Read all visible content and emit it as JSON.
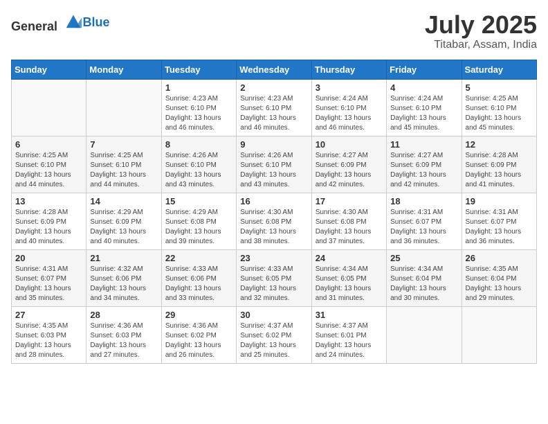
{
  "header": {
    "logo_general": "General",
    "logo_blue": "Blue",
    "month_year": "July 2025",
    "location": "Titabar, Assam, India"
  },
  "weekdays": [
    "Sunday",
    "Monday",
    "Tuesday",
    "Wednesday",
    "Thursday",
    "Friday",
    "Saturday"
  ],
  "weeks": [
    [
      {
        "day": "",
        "info": ""
      },
      {
        "day": "",
        "info": ""
      },
      {
        "day": "1",
        "info": "Sunrise: 4:23 AM\nSunset: 6:10 PM\nDaylight: 13 hours and 46 minutes."
      },
      {
        "day": "2",
        "info": "Sunrise: 4:23 AM\nSunset: 6:10 PM\nDaylight: 13 hours and 46 minutes."
      },
      {
        "day": "3",
        "info": "Sunrise: 4:24 AM\nSunset: 6:10 PM\nDaylight: 13 hours and 46 minutes."
      },
      {
        "day": "4",
        "info": "Sunrise: 4:24 AM\nSunset: 6:10 PM\nDaylight: 13 hours and 45 minutes."
      },
      {
        "day": "5",
        "info": "Sunrise: 4:25 AM\nSunset: 6:10 PM\nDaylight: 13 hours and 45 minutes."
      }
    ],
    [
      {
        "day": "6",
        "info": "Sunrise: 4:25 AM\nSunset: 6:10 PM\nDaylight: 13 hours and 44 minutes."
      },
      {
        "day": "7",
        "info": "Sunrise: 4:25 AM\nSunset: 6:10 PM\nDaylight: 13 hours and 44 minutes."
      },
      {
        "day": "8",
        "info": "Sunrise: 4:26 AM\nSunset: 6:10 PM\nDaylight: 13 hours and 43 minutes."
      },
      {
        "day": "9",
        "info": "Sunrise: 4:26 AM\nSunset: 6:10 PM\nDaylight: 13 hours and 43 minutes."
      },
      {
        "day": "10",
        "info": "Sunrise: 4:27 AM\nSunset: 6:09 PM\nDaylight: 13 hours and 42 minutes."
      },
      {
        "day": "11",
        "info": "Sunrise: 4:27 AM\nSunset: 6:09 PM\nDaylight: 13 hours and 42 minutes."
      },
      {
        "day": "12",
        "info": "Sunrise: 4:28 AM\nSunset: 6:09 PM\nDaylight: 13 hours and 41 minutes."
      }
    ],
    [
      {
        "day": "13",
        "info": "Sunrise: 4:28 AM\nSunset: 6:09 PM\nDaylight: 13 hours and 40 minutes."
      },
      {
        "day": "14",
        "info": "Sunrise: 4:29 AM\nSunset: 6:09 PM\nDaylight: 13 hours and 40 minutes."
      },
      {
        "day": "15",
        "info": "Sunrise: 4:29 AM\nSunset: 6:08 PM\nDaylight: 13 hours and 39 minutes."
      },
      {
        "day": "16",
        "info": "Sunrise: 4:30 AM\nSunset: 6:08 PM\nDaylight: 13 hours and 38 minutes."
      },
      {
        "day": "17",
        "info": "Sunrise: 4:30 AM\nSunset: 6:08 PM\nDaylight: 13 hours and 37 minutes."
      },
      {
        "day": "18",
        "info": "Sunrise: 4:31 AM\nSunset: 6:07 PM\nDaylight: 13 hours and 36 minutes."
      },
      {
        "day": "19",
        "info": "Sunrise: 4:31 AM\nSunset: 6:07 PM\nDaylight: 13 hours and 36 minutes."
      }
    ],
    [
      {
        "day": "20",
        "info": "Sunrise: 4:31 AM\nSunset: 6:07 PM\nDaylight: 13 hours and 35 minutes."
      },
      {
        "day": "21",
        "info": "Sunrise: 4:32 AM\nSunset: 6:06 PM\nDaylight: 13 hours and 34 minutes."
      },
      {
        "day": "22",
        "info": "Sunrise: 4:33 AM\nSunset: 6:06 PM\nDaylight: 13 hours and 33 minutes."
      },
      {
        "day": "23",
        "info": "Sunrise: 4:33 AM\nSunset: 6:05 PM\nDaylight: 13 hours and 32 minutes."
      },
      {
        "day": "24",
        "info": "Sunrise: 4:34 AM\nSunset: 6:05 PM\nDaylight: 13 hours and 31 minutes."
      },
      {
        "day": "25",
        "info": "Sunrise: 4:34 AM\nSunset: 6:04 PM\nDaylight: 13 hours and 30 minutes."
      },
      {
        "day": "26",
        "info": "Sunrise: 4:35 AM\nSunset: 6:04 PM\nDaylight: 13 hours and 29 minutes."
      }
    ],
    [
      {
        "day": "27",
        "info": "Sunrise: 4:35 AM\nSunset: 6:03 PM\nDaylight: 13 hours and 28 minutes."
      },
      {
        "day": "28",
        "info": "Sunrise: 4:36 AM\nSunset: 6:03 PM\nDaylight: 13 hours and 27 minutes."
      },
      {
        "day": "29",
        "info": "Sunrise: 4:36 AM\nSunset: 6:02 PM\nDaylight: 13 hours and 26 minutes."
      },
      {
        "day": "30",
        "info": "Sunrise: 4:37 AM\nSunset: 6:02 PM\nDaylight: 13 hours and 25 minutes."
      },
      {
        "day": "31",
        "info": "Sunrise: 4:37 AM\nSunset: 6:01 PM\nDaylight: 13 hours and 24 minutes."
      },
      {
        "day": "",
        "info": ""
      },
      {
        "day": "",
        "info": ""
      }
    ]
  ]
}
